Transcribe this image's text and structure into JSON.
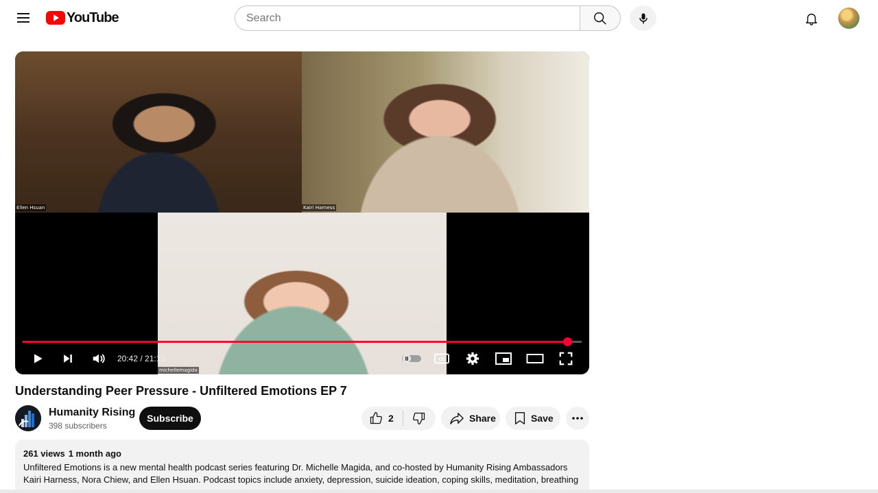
{
  "masthead": {
    "logo_text": "YouTube",
    "search_placeholder": "Search"
  },
  "player": {
    "participants": [
      "Ellen Hsuan",
      "Kairi Harness",
      "michellemagida"
    ],
    "time_display": "20:42 / 21:15",
    "progress": 0.974
  },
  "video": {
    "title": "Understanding Peer Pressure - Unfiltered Emotions EP 7"
  },
  "channel": {
    "name": "Humanity Rising",
    "subscribers": "398 subscribers",
    "subscribe_label": "Subscribe"
  },
  "actions": {
    "like_count": "2",
    "share_label": "Share",
    "save_label": "Save"
  },
  "description": {
    "views": "261 views",
    "date": "1 month ago",
    "text": "Unfiltered Emotions is a new mental health podcast series featuring Dr. Michelle Magida, and co-hosted by Humanity Rising Ambassadors Kairi Harness, Nora Chiew, and Ellen Hsuan. Podcast topics include anxiety, depression, suicide ideation, coping skills, meditation, breathing"
  },
  "colors": {
    "brand_red": "#ff0000",
    "progress_red": "#ff0033"
  }
}
